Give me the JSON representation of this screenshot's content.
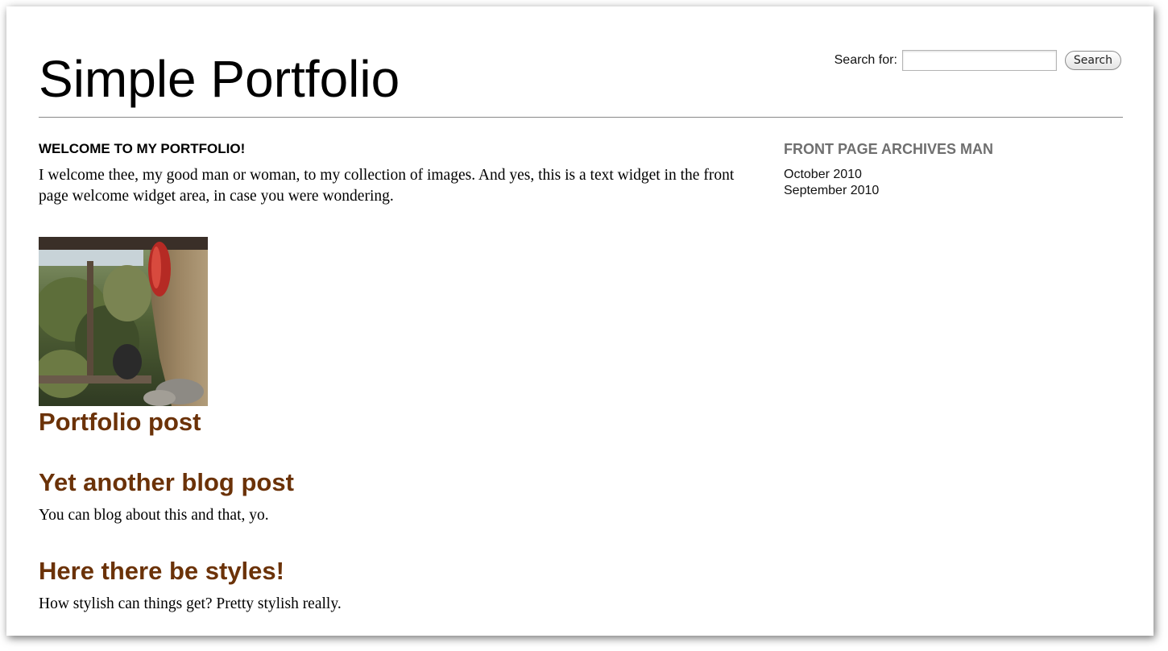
{
  "site": {
    "title": "Simple Portfolio"
  },
  "search": {
    "label": "Search for:",
    "value": "",
    "placeholder": "",
    "button_label": "Search"
  },
  "welcome": {
    "heading": "WELCOME TO MY PORTFOLIO!",
    "text": "I welcome thee, my good man or woman, to my collection of images. And yes, this is a text widget in the front page welcome widget area, in case you were wondering."
  },
  "posts": [
    {
      "title": "Portfolio post",
      "excerpt": "",
      "has_thumbnail": true
    },
    {
      "title": "Yet another blog post",
      "excerpt": "You can blog about this and that, yo."
    },
    {
      "title": "Here there be styles!",
      "excerpt": "How stylish can things get? Pretty stylish really."
    }
  ],
  "sidebar": {
    "widget_title": "FRONT PAGE ARCHIVES MAN",
    "archives": [
      {
        "label": "October 2010"
      },
      {
        "label": "September 2010"
      }
    ]
  },
  "colors": {
    "post_title": "#6b3208",
    "widget_title": "#6f6f6f",
    "divider": "#888888"
  }
}
